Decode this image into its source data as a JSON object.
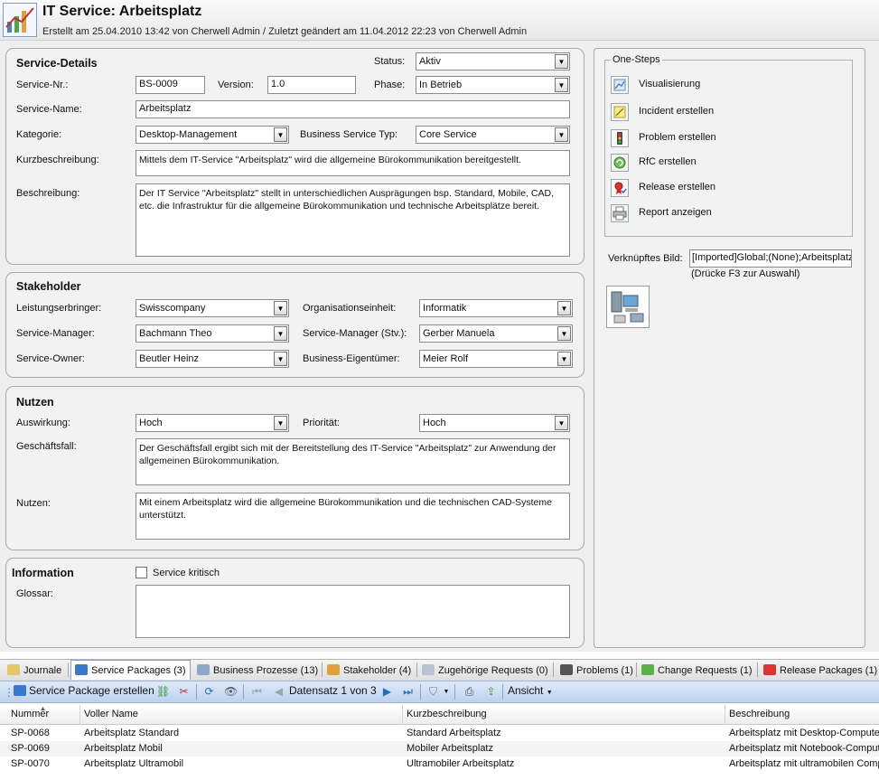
{
  "header": {
    "title": "IT Service: Arbeitsplatz",
    "subtitle": "Erstellt am 25.04.2010 13:42 von Cherwell Admin / Zuletzt geändert am 11.04.2012 22:23 von Cherwell Admin"
  },
  "service_details": {
    "title": "Service-Details",
    "status_label": "Status:",
    "status_value": "Aktiv",
    "nr_label": "Service-Nr.:",
    "nr_value": "BS-0009",
    "version_label": "Version:",
    "version_value": "1.0",
    "phase_label": "Phase:",
    "phase_value": "In Betrieb",
    "name_label": "Service-Name:",
    "name_value": "Arbeitsplatz",
    "kategorie_label": "Kategorie:",
    "kategorie_value": "Desktop-Management",
    "bst_label": "Business Service Typ:",
    "bst_value": "Core Service",
    "kurz_label": "Kurzbeschreibung:",
    "kurz_value": "Mittels dem IT-Service \"Arbeitsplatz\" wird die allgemeine Bürokommunikation bereitgestellt.",
    "beschr_label": "Beschreibung:",
    "beschr_value": "Der IT Service \"Arbeitsplatz\" stellt in unterschiedlichen Ausprägungen bsp. Standard, Mobile, CAD, etc. die Infrastruktur für die allgemeine Bürokommunikation und technische Arbeitsplätze bereit."
  },
  "stakeholder": {
    "title": "Stakeholder",
    "le_label": "Leistungserbringer:",
    "le_value": "Swisscompany",
    "oe_label": "Organisationseinheit:",
    "oe_value": "Informatik",
    "sm_label": "Service-Manager:",
    "sm_value": "Bachmann Theo",
    "smstv_label": "Service-Manager (Stv.):",
    "smstv_value": "Gerber Manuela",
    "so_label": "Service-Owner:",
    "so_value": "Beutler Heinz",
    "be_label": "Business-Eigentümer:",
    "be_value": "Meier Rolf"
  },
  "nutzen": {
    "title": "Nutzen",
    "auswirkung_label": "Auswirkung:",
    "auswirkung_value": "Hoch",
    "prio_label": "Priorität:",
    "prio_value": "Hoch",
    "gf_label": "Geschäftsfall:",
    "gf_value": "Der Geschäftsfall ergibt sich mit der Bereitstellung des IT-Service \"Arbeitsplatz\" zur Anwendung der allgemeinen Bürokommunikation.",
    "nutzen_label": "Nutzen:",
    "nutzen_value": "Mit einem Arbeitsplatz wird die allgemeine Bürokommunikation und die technischen CAD-Systeme unterstützt."
  },
  "information": {
    "title": "Information",
    "kritisch_label": "Service kritisch",
    "glossar_label": "Glossar:",
    "glossar_value": ""
  },
  "onesteps": {
    "title": "One-Steps",
    "items": [
      {
        "label": "Visualisierung",
        "icon": "chart-icon"
      },
      {
        "label": "Incident erstellen",
        "icon": "note-icon"
      },
      {
        "label": "Problem erstellen",
        "icon": "traffic-light-icon"
      },
      {
        "label": "RfC erstellen",
        "icon": "recycle-icon"
      },
      {
        "label": "Release erstellen",
        "icon": "ribbon-icon"
      },
      {
        "label": "Report anzeigen",
        "icon": "printer-icon"
      }
    ],
    "bild_label": "Verknüpftes Bild:",
    "bild_value": "[Imported]Global;(None);Arbeitsplatz",
    "bild_hint": "(Drücke F3 zur Auswahl)"
  },
  "tabs": [
    {
      "label": "Journale"
    },
    {
      "label": "Service Packages (3)"
    },
    {
      "label": "Business Prozesse (13)"
    },
    {
      "label": "Stakeholder (4)"
    },
    {
      "label": "Zugehörige Requests (0)"
    },
    {
      "label": "Problems (1)"
    },
    {
      "label": "Change Requests (1)"
    },
    {
      "label": "Release Packages (1)"
    }
  ],
  "toolbar": {
    "create_label": "Service Package erstellen",
    "record_label": "Datensatz 1 von 3",
    "view_label": "Ansicht"
  },
  "grid": {
    "columns": [
      "Nummer",
      "Voller Name",
      "Kurzbeschreibung",
      "Beschreibung"
    ],
    "rows": [
      [
        "SP-0068",
        "Arbeitsplatz Standard",
        "Standard Arbeitsplatz",
        "Arbeitsplatz mit Desktop-Computer"
      ],
      [
        "SP-0069",
        "Arbeitsplatz Mobil",
        "Mobiler Arbeitsplatz",
        "Arbeitsplatz mit Notebook-Computer"
      ],
      [
        "SP-0070",
        "Arbeitsplatz Ultramobil",
        "Ultramobiler Arbeitsplatz",
        "Arbeitsplatz mit ultramobilen Computer"
      ]
    ]
  }
}
